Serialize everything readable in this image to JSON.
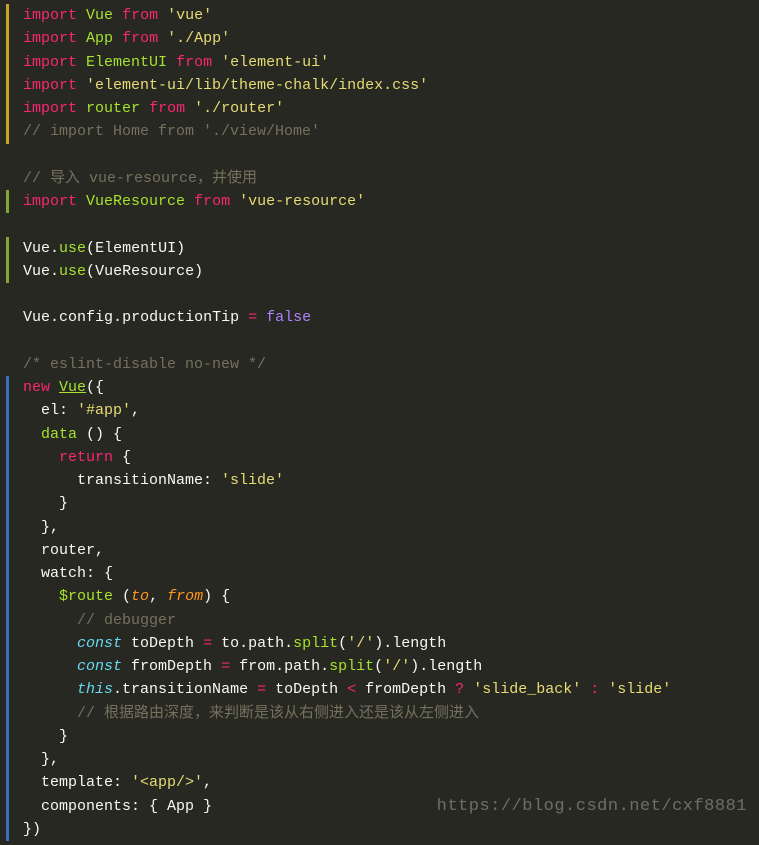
{
  "lines": [
    {
      "g": "yellow",
      "tokens": [
        [
          "kw-red",
          "import"
        ],
        [
          "plain",
          " "
        ],
        [
          "fn-green",
          "Vue"
        ],
        [
          "plain",
          " "
        ],
        [
          "kw-red",
          "from"
        ],
        [
          "plain",
          " "
        ],
        [
          "str",
          "'vue'"
        ]
      ]
    },
    {
      "g": "yellow",
      "tokens": [
        [
          "kw-red",
          "import"
        ],
        [
          "plain",
          " "
        ],
        [
          "fn-green",
          "App"
        ],
        [
          "plain",
          " "
        ],
        [
          "kw-red",
          "from"
        ],
        [
          "plain",
          " "
        ],
        [
          "str",
          "'./App'"
        ]
      ]
    },
    {
      "g": "yellow",
      "tokens": [
        [
          "kw-red",
          "import"
        ],
        [
          "plain",
          " "
        ],
        [
          "fn-green",
          "ElementUI"
        ],
        [
          "plain",
          " "
        ],
        [
          "kw-red",
          "from"
        ],
        [
          "plain",
          " "
        ],
        [
          "str",
          "'element-ui'"
        ]
      ]
    },
    {
      "g": "yellow",
      "tokens": [
        [
          "kw-red",
          "import"
        ],
        [
          "plain",
          " "
        ],
        [
          "str",
          "'element-ui/lib/theme-chalk/index.css'"
        ]
      ]
    },
    {
      "g": "yellow",
      "tokens": [
        [
          "kw-red",
          "import"
        ],
        [
          "plain",
          " "
        ],
        [
          "fn-green",
          "router"
        ],
        [
          "plain",
          " "
        ],
        [
          "kw-red",
          "from"
        ],
        [
          "plain",
          " "
        ],
        [
          "str",
          "'./router'"
        ]
      ]
    },
    {
      "g": "yellow",
      "tokens": [
        [
          "comment",
          "// import Home from './view/Home'"
        ]
      ]
    },
    {
      "g": "",
      "tokens": [
        [
          "plain",
          " "
        ]
      ]
    },
    {
      "g": "",
      "tokens": [
        [
          "comment",
          "// 导入 vue-resource，并使用"
        ]
      ]
    },
    {
      "g": "green",
      "tokens": [
        [
          "kw-red",
          "import"
        ],
        [
          "plain",
          " "
        ],
        [
          "fn-green",
          "VueResource"
        ],
        [
          "plain",
          " "
        ],
        [
          "kw-red",
          "from"
        ],
        [
          "plain",
          " "
        ],
        [
          "str",
          "'vue-resource'"
        ]
      ]
    },
    {
      "g": "",
      "tokens": [
        [
          "plain",
          " "
        ]
      ]
    },
    {
      "g": "green",
      "tokens": [
        [
          "plain",
          "Vue"
        ],
        [
          "plain",
          "."
        ],
        [
          "fn-green",
          "use"
        ],
        [
          "plain",
          "("
        ],
        [
          "plain",
          "ElementUI"
        ],
        [
          "plain",
          ")"
        ]
      ]
    },
    {
      "g": "green",
      "tokens": [
        [
          "plain",
          "Vue"
        ],
        [
          "plain",
          "."
        ],
        [
          "fn-green",
          "use"
        ],
        [
          "plain",
          "("
        ],
        [
          "plain",
          "VueResource"
        ],
        [
          "plain",
          ")"
        ]
      ]
    },
    {
      "g": "",
      "tokens": [
        [
          "plain",
          " "
        ]
      ]
    },
    {
      "g": "",
      "tokens": [
        [
          "plain",
          "Vue"
        ],
        [
          "plain",
          "."
        ],
        [
          "plain",
          "config"
        ],
        [
          "plain",
          "."
        ],
        [
          "plain",
          "productionTip"
        ],
        [
          "plain",
          " "
        ],
        [
          "kw-red",
          "="
        ],
        [
          "plain",
          " "
        ],
        [
          "const",
          "false"
        ]
      ]
    },
    {
      "g": "",
      "tokens": [
        [
          "plain",
          " "
        ]
      ]
    },
    {
      "g": "",
      "tokens": [
        [
          "comment",
          "/* eslint-disable no-new */"
        ]
      ]
    },
    {
      "g": "blue",
      "tokens": [
        [
          "kw-red",
          "new"
        ],
        [
          "plain",
          " "
        ],
        [
          "fn-greenU",
          "Vue"
        ],
        [
          "plain",
          "({"
        ]
      ]
    },
    {
      "g": "blue",
      "tokens": [
        [
          "plain",
          "  el"
        ],
        [
          "plain",
          ": "
        ],
        [
          "str",
          "'#app'"
        ],
        [
          "plain",
          ","
        ]
      ]
    },
    {
      "g": "blue",
      "tokens": [
        [
          "plain",
          "  "
        ],
        [
          "fn-green",
          "data"
        ],
        [
          "plain",
          " () {"
        ]
      ]
    },
    {
      "g": "blue",
      "tokens": [
        [
          "plain",
          "    "
        ],
        [
          "kw-red",
          "return"
        ],
        [
          "plain",
          " {"
        ]
      ]
    },
    {
      "g": "blue",
      "tokens": [
        [
          "plain",
          "      transitionName"
        ],
        [
          "plain",
          ": "
        ],
        [
          "str",
          "'slide'"
        ]
      ]
    },
    {
      "g": "blue",
      "tokens": [
        [
          "plain",
          "    }"
        ]
      ]
    },
    {
      "g": "blue",
      "tokens": [
        [
          "plain",
          "  },"
        ]
      ]
    },
    {
      "g": "blue",
      "tokens": [
        [
          "plain",
          "  router,"
        ]
      ]
    },
    {
      "g": "blue",
      "tokens": [
        [
          "plain",
          "  watch"
        ],
        [
          "plain",
          ": {"
        ]
      ]
    },
    {
      "g": "blue",
      "tokens": [
        [
          "plain",
          "    "
        ],
        [
          "fn-green",
          "$route"
        ],
        [
          "plain",
          " ("
        ],
        [
          "param",
          "to"
        ],
        [
          "plain",
          ", "
        ],
        [
          "param",
          "from"
        ],
        [
          "plain",
          ") {"
        ]
      ]
    },
    {
      "g": "blue",
      "tokens": [
        [
          "plain",
          "      "
        ],
        [
          "comment",
          "// debugger"
        ]
      ]
    },
    {
      "g": "blue",
      "tokens": [
        [
          "plain",
          "      "
        ],
        [
          "storage",
          "const"
        ],
        [
          "plain",
          " "
        ],
        [
          "plain",
          "toDepth"
        ],
        [
          "plain",
          " "
        ],
        [
          "kw-red",
          "="
        ],
        [
          "plain",
          " to"
        ],
        [
          "plain",
          "."
        ],
        [
          "plain",
          "path"
        ],
        [
          "plain",
          "."
        ],
        [
          "fn-green",
          "split"
        ],
        [
          "plain",
          "("
        ],
        [
          "str",
          "'/'"
        ],
        [
          "plain",
          ")"
        ],
        [
          "plain",
          "."
        ],
        [
          "plain",
          "length"
        ]
      ]
    },
    {
      "g": "blue",
      "tokens": [
        [
          "plain",
          "      "
        ],
        [
          "storage",
          "const"
        ],
        [
          "plain",
          " "
        ],
        [
          "plain",
          "fromDepth"
        ],
        [
          "plain",
          " "
        ],
        [
          "kw-red",
          "="
        ],
        [
          "plain",
          " from"
        ],
        [
          "plain",
          "."
        ],
        [
          "plain",
          "path"
        ],
        [
          "plain",
          "."
        ],
        [
          "fn-green",
          "split"
        ],
        [
          "plain",
          "("
        ],
        [
          "str",
          "'/'"
        ],
        [
          "plain",
          ")"
        ],
        [
          "plain",
          "."
        ],
        [
          "plain",
          "length"
        ]
      ]
    },
    {
      "g": "blue",
      "tokens": [
        [
          "plain",
          "      "
        ],
        [
          "storage",
          "this"
        ],
        [
          "plain",
          "."
        ],
        [
          "plain",
          "transitionName"
        ],
        [
          "plain",
          " "
        ],
        [
          "kw-red",
          "="
        ],
        [
          "plain",
          " toDepth "
        ],
        [
          "kw-red",
          "<"
        ],
        [
          "plain",
          " fromDepth "
        ],
        [
          "kw-red",
          "?"
        ],
        [
          "plain",
          " "
        ],
        [
          "str",
          "'slide_back'"
        ],
        [
          "plain",
          " "
        ],
        [
          "kw-red",
          ":"
        ],
        [
          "plain",
          " "
        ],
        [
          "str",
          "'slide'"
        ]
      ]
    },
    {
      "g": "blue",
      "tokens": [
        [
          "plain",
          "      "
        ],
        [
          "comment",
          "// 根据路由深度，来判断是该从右侧进入还是该从左侧进入"
        ]
      ]
    },
    {
      "g": "blue",
      "tokens": [
        [
          "plain",
          "    }"
        ]
      ]
    },
    {
      "g": "blue",
      "tokens": [
        [
          "plain",
          "  },"
        ]
      ]
    },
    {
      "g": "blue",
      "tokens": [
        [
          "plain",
          "  template"
        ],
        [
          "plain",
          ": "
        ],
        [
          "str",
          "'<app/>'"
        ],
        [
          "plain",
          ","
        ]
      ]
    },
    {
      "g": "blue",
      "tokens": [
        [
          "plain",
          "  components"
        ],
        [
          "plain",
          ": { App }"
        ]
      ]
    },
    {
      "g": "blue",
      "tokens": [
        [
          "plain",
          "})"
        ]
      ]
    }
  ],
  "watermark": "https://blog.csdn.net/cxf8881"
}
